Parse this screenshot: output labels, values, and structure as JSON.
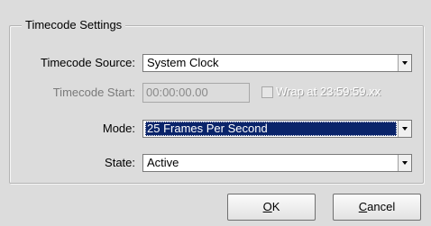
{
  "dialog": {
    "group_title": "Timecode Settings",
    "timecode_source": {
      "label": "Timecode Source:",
      "value": "System Clock"
    },
    "timecode_start": {
      "label": "Timecode Start:",
      "value": "00:00:00.00"
    },
    "wrap": {
      "label": "Wrap at 23:59:59.xx",
      "checked": false
    },
    "mode": {
      "label": "Mode:",
      "value": "25 Frames Per Second"
    },
    "state": {
      "label": "State:",
      "value": "Active"
    },
    "ok_button": {
      "accel": "O",
      "rest": "K"
    },
    "cancel_button": {
      "accel": "C",
      "rest": "ancel"
    }
  },
  "colors": {
    "background": "#dcdcdc",
    "selection": "#0a246a"
  },
  "icons": {
    "dropdown": "chevron-down-icon"
  }
}
